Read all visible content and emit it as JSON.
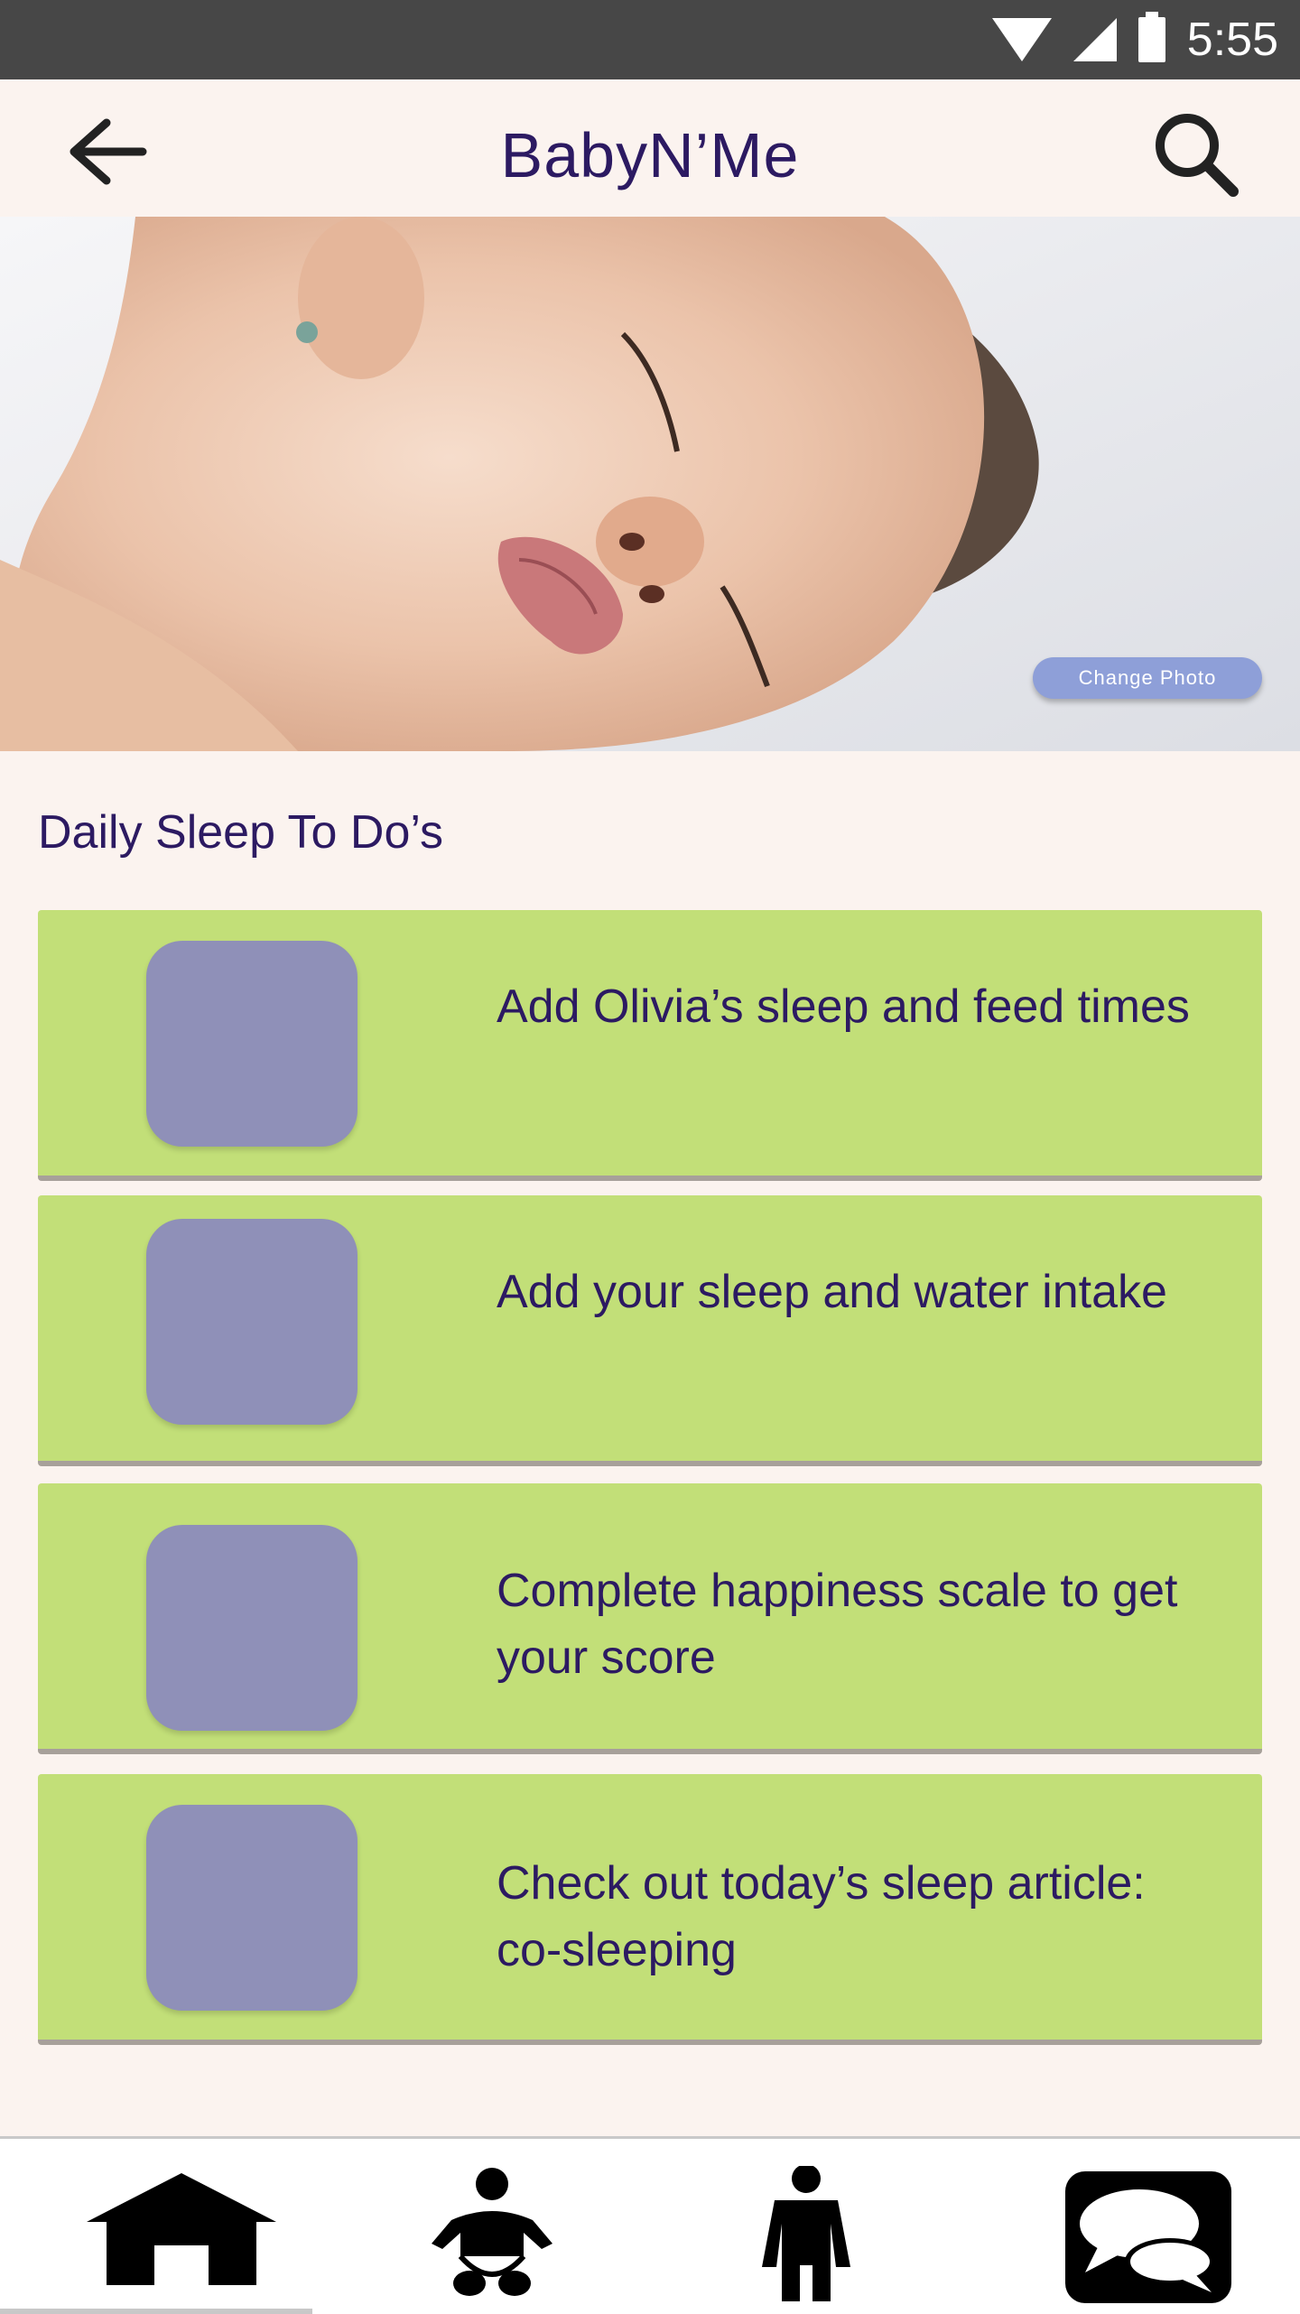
{
  "status_bar": {
    "time": "5:55"
  },
  "app_bar": {
    "title": "BabyN’Me"
  },
  "hero": {
    "change_photo_label": "Change Photo"
  },
  "section": {
    "title": "Daily Sleep To Do’s"
  },
  "tasks": [
    {
      "label": "Add Olivia’s sleep and feed times"
    },
    {
      "label": "Add your sleep and water intake"
    },
    {
      "label": "Complete happiness scale to get your score"
    },
    {
      "label": "Check out today’s sleep article: co-sleeping"
    }
  ],
  "bottom_nav": [
    {
      "icon": "home-icon"
    },
    {
      "icon": "baby-icon"
    },
    {
      "icon": "mother-icon"
    },
    {
      "icon": "chat-icon"
    }
  ],
  "colors": {
    "accent": "#2c1a62",
    "card": "#c2df78",
    "thumb": "#8f90b8",
    "button": "#8e9fd8",
    "background": "#fbf3ef"
  }
}
